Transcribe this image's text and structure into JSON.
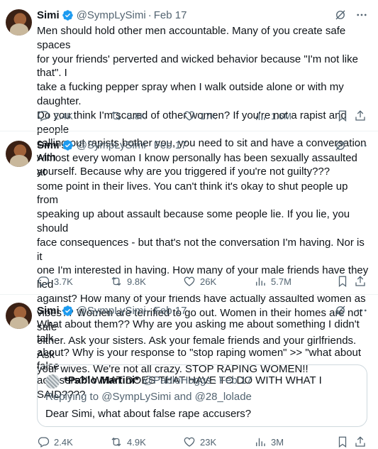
{
  "colors": {
    "accent": "#1d9bf0",
    "muted": "#536471",
    "text": "#0f1419",
    "border": "#cfd9de"
  },
  "tweets": [
    {
      "name": "Simi",
      "handle": "@SympLySimi",
      "separator": "·",
      "date": "Feb 17",
      "text": "Men should hold other men accountable. Many of you create safe spaces\nfor your friends' perverted and wicked behavior because \"I'm not like that\". I\ntake a fucking pepper spray when I walk outside alone or with my daughter.\nDo you think I'm scared of other women? If you're not a rapist and people\ncalling out rapists bother you, you need to sit and have a conversation with\nyourself. Because why are you triggered if you're not guilty???",
      "replies": "2.4K",
      "retweets": "5.8K",
      "likes": "17K",
      "views": "1.6M"
    },
    {
      "name": "Simi",
      "handle": "@SympLySimi",
      "separator": "·",
      "date": "Feb 17",
      "text": "Almost every woman I know personally has been sexually assaulted at\nsome point in their lives. You can't think it's okay to shut people up from\nspeaking up about assault because some people lie. If you lie, you should\nface consequences - but that's not the conversation I'm having. Nor is it\none I'm interested in having. How many of your male friends have they lied\nagainst? How many of your friends have actually assaulted women as\nvibes?? Women are terrified to go out. Women in their homes are not safe\neither. Ask your sisters. Ask your female friends and your girlfriends. Ask\nyour wives. We're not all crazy. STOP RAPING WOMEN!!",
      "replies": "3.7K",
      "retweets": "9.8K",
      "likes": "26K",
      "views": "5.7M"
    },
    {
      "name": "Simi",
      "handle": "@SympLySimi",
      "separator": "·",
      "date": "Feb 17",
      "text": "What about them?? Why are you asking me about something I didn't talk\nabout? Why is your response to \"stop raping women\" >> \"what about false\naccusers?\" WHAT DOES THAT HAVE TO DO WITH WHAT I SAID????",
      "quote": {
        "name": "*Pablo Martini*",
        "handle": "@PabloHoggs",
        "separator": "·",
        "date": "Feb 17",
        "replying_to": "Replying to @SympLySimi and @28_lolade",
        "text": "Dear Simi, what about false rape accusers?"
      },
      "replies": "2.4K",
      "retweets": "4.9K",
      "likes": "23K",
      "views": "3M"
    }
  ]
}
